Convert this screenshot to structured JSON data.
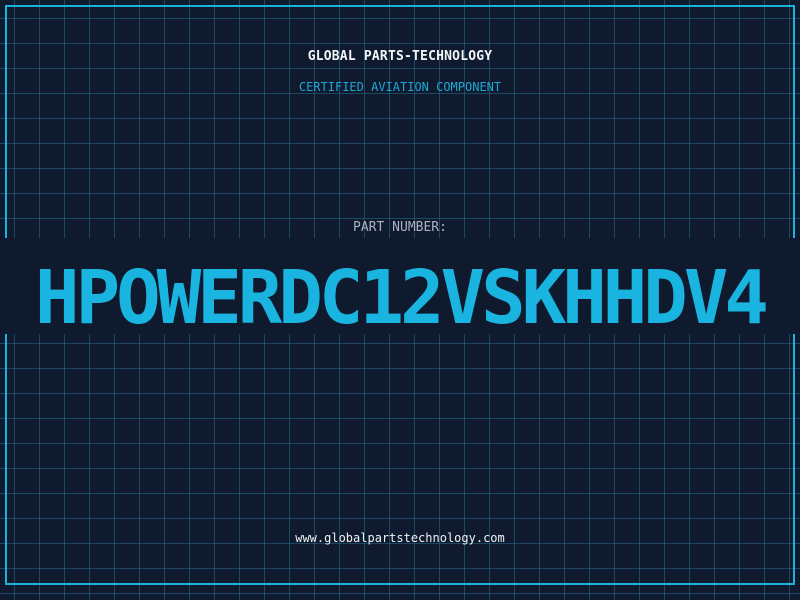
{
  "header": {
    "company": "GLOBAL PARTS-TECHNOLOGY",
    "subtitle": "CERTIFIED AVIATION COMPONENT"
  },
  "part": {
    "label": "PART NUMBER:",
    "number": "HPOWERDC12VSKHHDV4"
  },
  "footer": {
    "website": "www.globalpartstechnology.com"
  },
  "colors": {
    "background": "#0f1a2e",
    "grid": "#266e8c",
    "accent": "#19b5e0",
    "text": "#f2f5f8",
    "muted": "#a9b3c2"
  }
}
